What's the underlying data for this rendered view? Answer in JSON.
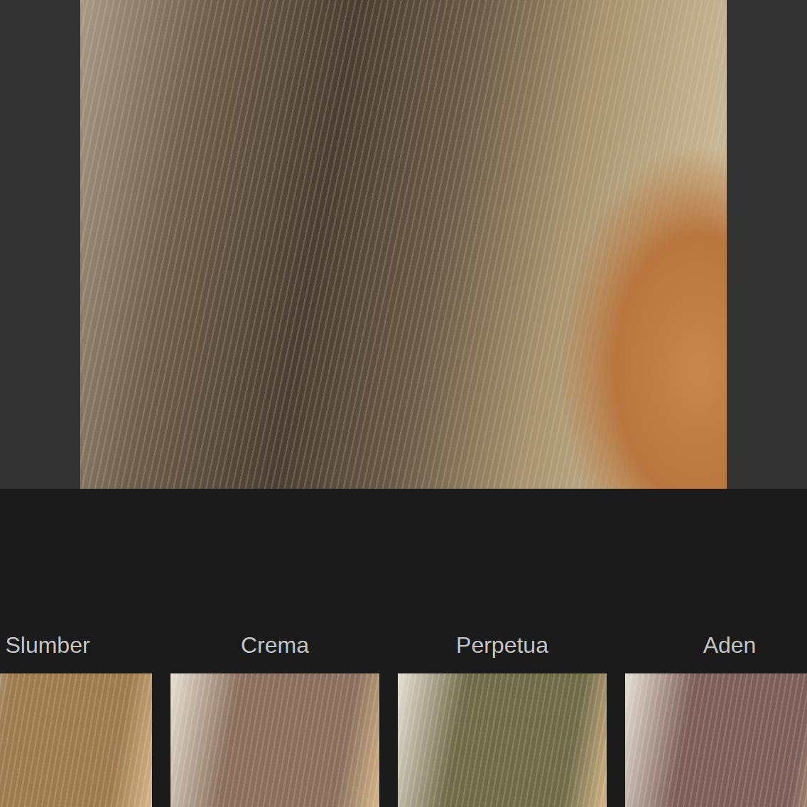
{
  "filters": [
    {
      "name": "Slumber",
      "color": "#9c7a4e"
    },
    {
      "name": "Crema",
      "color": "#8a6f5c"
    },
    {
      "name": "Perpetua",
      "color": "#6f6a48"
    },
    {
      "name": "Aden",
      "color": "#7d5f5a"
    }
  ]
}
